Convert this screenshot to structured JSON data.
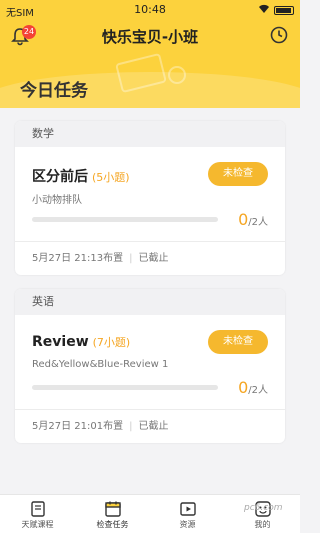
{
  "status": {
    "carrier": "无SIM",
    "time": "10:48"
  },
  "header": {
    "title": "快乐宝贝-小班",
    "notification_count": "24",
    "section_title": "今日任务",
    "accent": "#fcd23d"
  },
  "tasks": [
    {
      "subject": "数学",
      "title": "区分前后",
      "count_label": "(5小题)",
      "description": "小动物排队",
      "button": "未检查",
      "done": "0",
      "total": "/2人",
      "progress": 0,
      "published": "5月27日 21:13布置",
      "deadline": "已截止"
    },
    {
      "subject": "英语",
      "title": "Review",
      "count_label": "(7小题)",
      "description": "Red&Yellow&Blue-Review 1",
      "button": "未检查",
      "done": "0",
      "total": "/2人",
      "progress": 0,
      "published": "5月27日 21:01布置",
      "deadline": "已截止"
    }
  ],
  "tabs": [
    {
      "label": "天赋课程",
      "icon": "book-icon"
    },
    {
      "label": "检查任务",
      "icon": "calendar-icon",
      "active": true
    },
    {
      "label": "资源",
      "icon": "play-icon"
    },
    {
      "label": "我的",
      "icon": "face-icon"
    }
  ],
  "watermark": "pc6.com"
}
